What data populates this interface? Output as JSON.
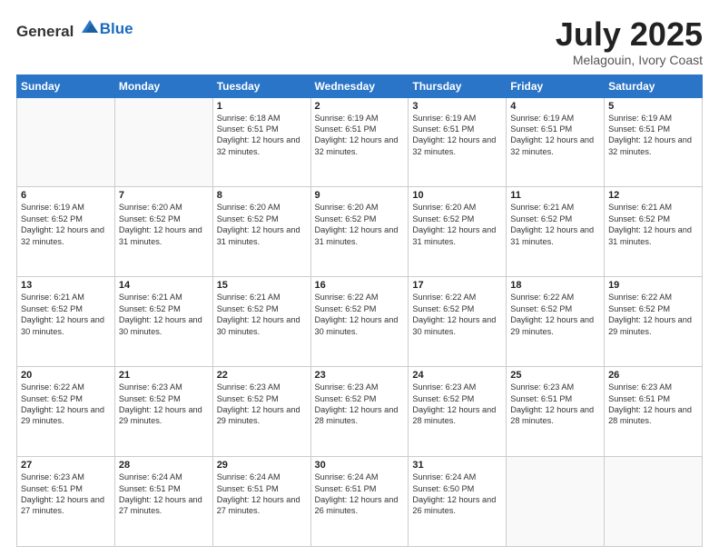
{
  "header": {
    "logo_general": "General",
    "logo_blue": "Blue",
    "title": "July 2025",
    "location": "Melagouin, Ivory Coast"
  },
  "days_of_week": [
    "Sunday",
    "Monday",
    "Tuesday",
    "Wednesday",
    "Thursday",
    "Friday",
    "Saturday"
  ],
  "weeks": [
    [
      {
        "day": "",
        "info": ""
      },
      {
        "day": "",
        "info": ""
      },
      {
        "day": "1",
        "info": "Sunrise: 6:18 AM\nSunset: 6:51 PM\nDaylight: 12 hours and 32 minutes."
      },
      {
        "day": "2",
        "info": "Sunrise: 6:19 AM\nSunset: 6:51 PM\nDaylight: 12 hours and 32 minutes."
      },
      {
        "day": "3",
        "info": "Sunrise: 6:19 AM\nSunset: 6:51 PM\nDaylight: 12 hours and 32 minutes."
      },
      {
        "day": "4",
        "info": "Sunrise: 6:19 AM\nSunset: 6:51 PM\nDaylight: 12 hours and 32 minutes."
      },
      {
        "day": "5",
        "info": "Sunrise: 6:19 AM\nSunset: 6:51 PM\nDaylight: 12 hours and 32 minutes."
      }
    ],
    [
      {
        "day": "6",
        "info": "Sunrise: 6:19 AM\nSunset: 6:52 PM\nDaylight: 12 hours and 32 minutes."
      },
      {
        "day": "7",
        "info": "Sunrise: 6:20 AM\nSunset: 6:52 PM\nDaylight: 12 hours and 31 minutes."
      },
      {
        "day": "8",
        "info": "Sunrise: 6:20 AM\nSunset: 6:52 PM\nDaylight: 12 hours and 31 minutes."
      },
      {
        "day": "9",
        "info": "Sunrise: 6:20 AM\nSunset: 6:52 PM\nDaylight: 12 hours and 31 minutes."
      },
      {
        "day": "10",
        "info": "Sunrise: 6:20 AM\nSunset: 6:52 PM\nDaylight: 12 hours and 31 minutes."
      },
      {
        "day": "11",
        "info": "Sunrise: 6:21 AM\nSunset: 6:52 PM\nDaylight: 12 hours and 31 minutes."
      },
      {
        "day": "12",
        "info": "Sunrise: 6:21 AM\nSunset: 6:52 PM\nDaylight: 12 hours and 31 minutes."
      }
    ],
    [
      {
        "day": "13",
        "info": "Sunrise: 6:21 AM\nSunset: 6:52 PM\nDaylight: 12 hours and 30 minutes."
      },
      {
        "day": "14",
        "info": "Sunrise: 6:21 AM\nSunset: 6:52 PM\nDaylight: 12 hours and 30 minutes."
      },
      {
        "day": "15",
        "info": "Sunrise: 6:21 AM\nSunset: 6:52 PM\nDaylight: 12 hours and 30 minutes."
      },
      {
        "day": "16",
        "info": "Sunrise: 6:22 AM\nSunset: 6:52 PM\nDaylight: 12 hours and 30 minutes."
      },
      {
        "day": "17",
        "info": "Sunrise: 6:22 AM\nSunset: 6:52 PM\nDaylight: 12 hours and 30 minutes."
      },
      {
        "day": "18",
        "info": "Sunrise: 6:22 AM\nSunset: 6:52 PM\nDaylight: 12 hours and 29 minutes."
      },
      {
        "day": "19",
        "info": "Sunrise: 6:22 AM\nSunset: 6:52 PM\nDaylight: 12 hours and 29 minutes."
      }
    ],
    [
      {
        "day": "20",
        "info": "Sunrise: 6:22 AM\nSunset: 6:52 PM\nDaylight: 12 hours and 29 minutes."
      },
      {
        "day": "21",
        "info": "Sunrise: 6:23 AM\nSunset: 6:52 PM\nDaylight: 12 hours and 29 minutes."
      },
      {
        "day": "22",
        "info": "Sunrise: 6:23 AM\nSunset: 6:52 PM\nDaylight: 12 hours and 29 minutes."
      },
      {
        "day": "23",
        "info": "Sunrise: 6:23 AM\nSunset: 6:52 PM\nDaylight: 12 hours and 28 minutes."
      },
      {
        "day": "24",
        "info": "Sunrise: 6:23 AM\nSunset: 6:52 PM\nDaylight: 12 hours and 28 minutes."
      },
      {
        "day": "25",
        "info": "Sunrise: 6:23 AM\nSunset: 6:51 PM\nDaylight: 12 hours and 28 minutes."
      },
      {
        "day": "26",
        "info": "Sunrise: 6:23 AM\nSunset: 6:51 PM\nDaylight: 12 hours and 28 minutes."
      }
    ],
    [
      {
        "day": "27",
        "info": "Sunrise: 6:23 AM\nSunset: 6:51 PM\nDaylight: 12 hours and 27 minutes."
      },
      {
        "day": "28",
        "info": "Sunrise: 6:24 AM\nSunset: 6:51 PM\nDaylight: 12 hours and 27 minutes."
      },
      {
        "day": "29",
        "info": "Sunrise: 6:24 AM\nSunset: 6:51 PM\nDaylight: 12 hours and 27 minutes."
      },
      {
        "day": "30",
        "info": "Sunrise: 6:24 AM\nSunset: 6:51 PM\nDaylight: 12 hours and 26 minutes."
      },
      {
        "day": "31",
        "info": "Sunrise: 6:24 AM\nSunset: 6:50 PM\nDaylight: 12 hours and 26 minutes."
      },
      {
        "day": "",
        "info": ""
      },
      {
        "day": "",
        "info": ""
      }
    ]
  ]
}
